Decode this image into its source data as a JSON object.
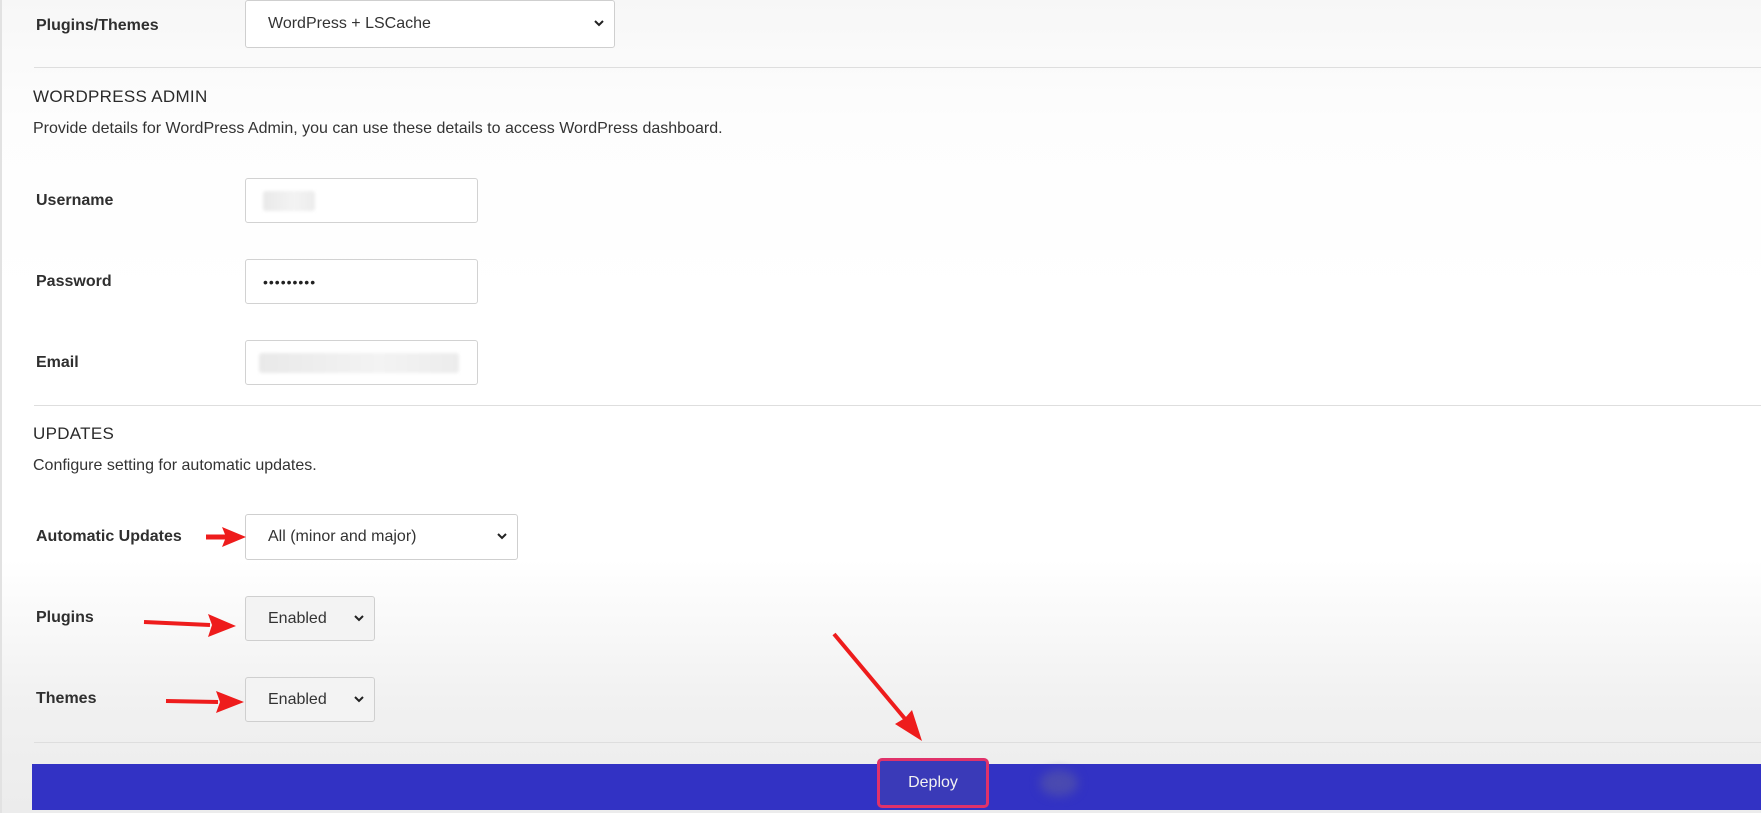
{
  "plugins_themes": {
    "label": "Plugins/Themes",
    "value": "WordPress + LSCache"
  },
  "wordpress_admin": {
    "title": "WORDPRESS ADMIN",
    "description": "Provide details for WordPress Admin, you can use these details to access WordPress dashboard.",
    "username_label": "Username",
    "password_label": "Password",
    "password_value": "•••••••••",
    "email_label": "Email"
  },
  "updates": {
    "title": "UPDATES",
    "description": "Configure setting for automatic updates.",
    "automatic_label": "Automatic Updates",
    "automatic_value": "All (minor and major)",
    "plugins_label": "Plugins",
    "plugins_value": "Enabled",
    "themes_label": "Themes",
    "themes_value": "Enabled"
  },
  "actions": {
    "deploy_label": "Deploy"
  },
  "colors": {
    "deploy_bar": "#3232c4",
    "highlight": "#e0326a",
    "annotation_arrow": "#ee1c1c"
  },
  "icons": [
    "chevron-down-icon",
    "red-arrow-annotation"
  ]
}
